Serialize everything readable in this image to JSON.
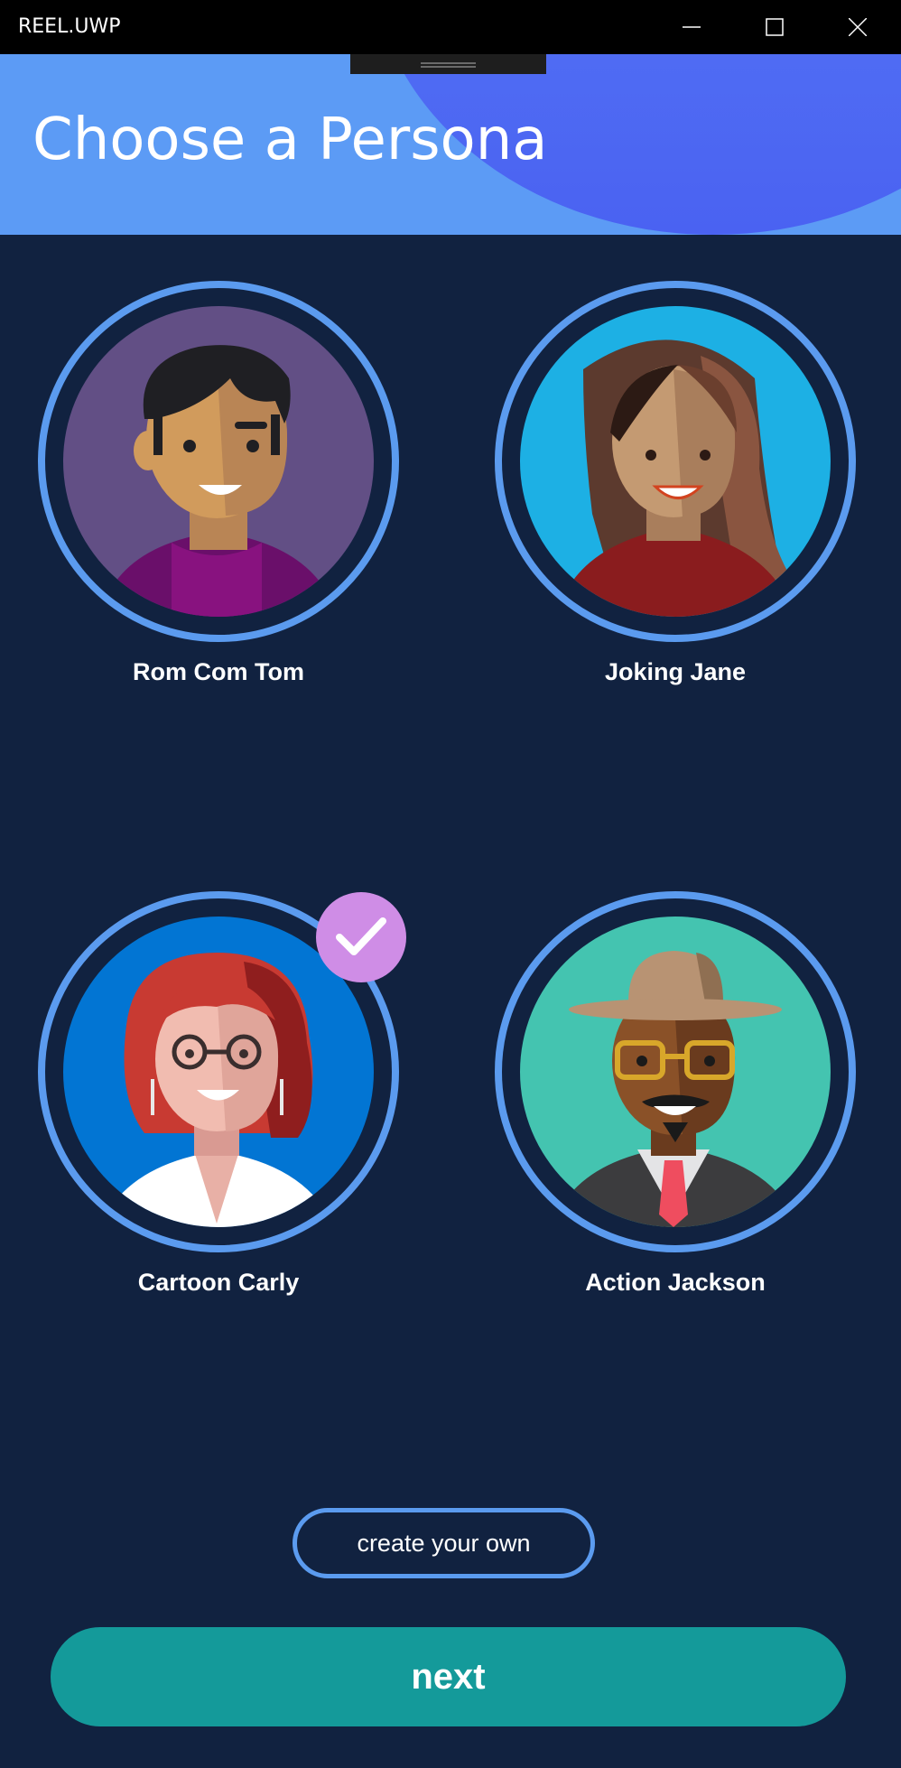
{
  "window": {
    "title": "REEL.UWP",
    "controls": [
      "minimize-icon",
      "maximize-icon",
      "close-icon"
    ]
  },
  "header": {
    "title": "Choose a Persona"
  },
  "personas": [
    {
      "name": "Rom Com Tom",
      "bg": "#624f85",
      "selected": false
    },
    {
      "name": "Joking Jane",
      "bg": "#1db0e4",
      "selected": false
    },
    {
      "name": "Cartoon Carly",
      "bg": "#0275d3",
      "selected": true
    },
    {
      "name": "Action Jackson",
      "bg": "#44c4b0",
      "selected": false
    }
  ],
  "actions": {
    "create_label": "create your own",
    "next_label": "next"
  },
  "colors": {
    "background": "#112240",
    "accent_ring": "#5b9bef",
    "check_badge": "#cf8de6",
    "next_button": "#149a9a"
  }
}
